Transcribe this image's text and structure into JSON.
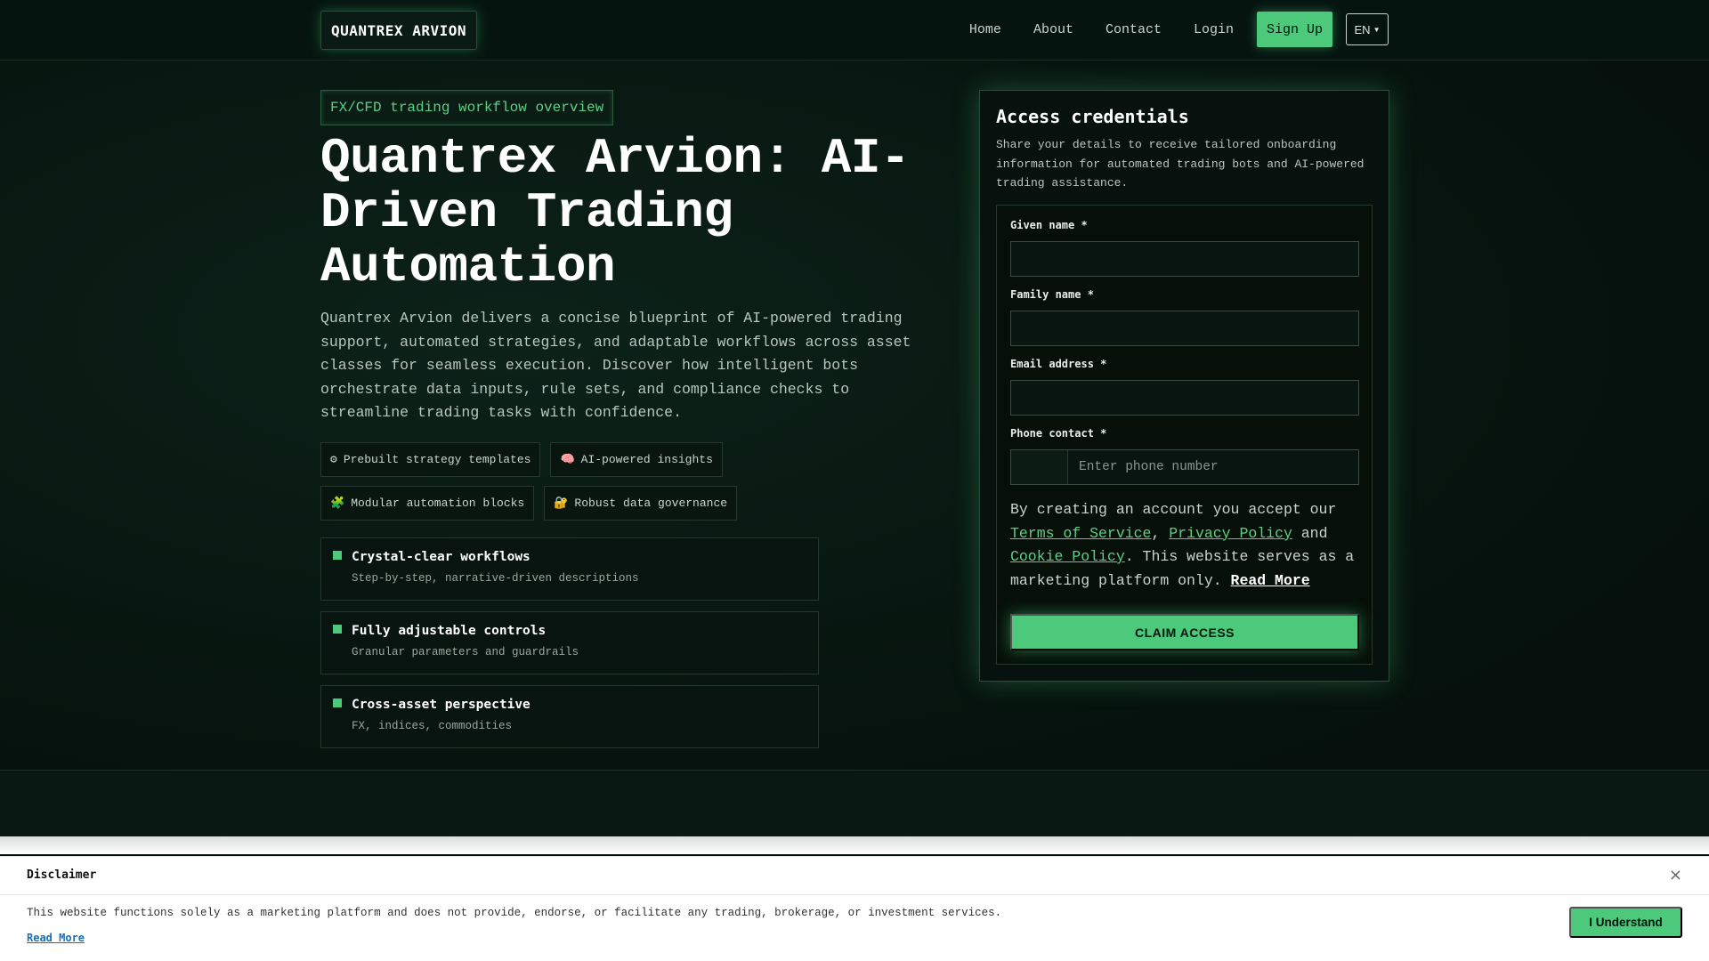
{
  "brand": {
    "logo_text": "QUANTREX ARVION"
  },
  "nav": {
    "links": [
      "Home",
      "About",
      "Contact",
      "Login"
    ],
    "signup_label": "Sign Up",
    "lang_label": "EN"
  },
  "hero": {
    "tag": "FX/CFD trading workflow overview",
    "title": "Quantrex Arvion: AI-Driven Trading Automation",
    "description": "Quantrex Arvion delivers a concise blueprint of AI-powered trading support, automated strategies, and adaptable workflows across asset classes for seamless execution. Discover how intelligent bots orchestrate data inputs, rule sets, and compliance checks to streamline trading tasks with confidence.",
    "chips": [
      {
        "icon": "⚙",
        "label": "Prebuilt strategy templates"
      },
      {
        "icon": "🧠",
        "label": "AI-powered insights"
      },
      {
        "icon": "🧩",
        "label": "Modular automation blocks"
      },
      {
        "icon": "🔐",
        "label": "Robust data governance"
      }
    ],
    "features": [
      {
        "title": "Crystal-clear workflows",
        "subtitle": "Step-by-step, narrative-driven descriptions"
      },
      {
        "title": "Fully adjustable controls",
        "subtitle": "Granular parameters and guardrails"
      },
      {
        "title": "Cross-asset perspective",
        "subtitle": "FX, indices, commodities"
      }
    ]
  },
  "form": {
    "title": "Access credentials",
    "subtitle": "Share your details to receive tailored onboarding information for automated trading bots and AI-powered trading assistance.",
    "fields": {
      "given_name": {
        "label": "Given name *",
        "value": ""
      },
      "family_name": {
        "label": "Family name *",
        "value": ""
      },
      "email": {
        "label": "Email address *",
        "value": ""
      },
      "phone": {
        "label": "Phone contact *",
        "placeholder": "Enter phone number"
      }
    },
    "terms": {
      "prefix": "By creating an account you accept our ",
      "tos": "Terms of Service",
      "sep": ", ",
      "privacy": "Privacy Policy",
      "and": " and ",
      "cookie": "Cookie Policy",
      "suffix": ". This website serves as a marketing platform only. ",
      "read_more": "Read More"
    },
    "submit_label": "CLAIM ACCESS"
  },
  "disclaimer": {
    "title": "Disclaimer",
    "close_icon": "×",
    "text": "This website functions solely as a marketing platform and does not provide, endorse, or facilitate any trading, brokerage, or investment services.",
    "read_more": "Read More",
    "accept_label": "I Understand"
  },
  "colors": {
    "accent": "#4cc97a",
    "background": "#06110d",
    "text": "#e8efe9"
  }
}
